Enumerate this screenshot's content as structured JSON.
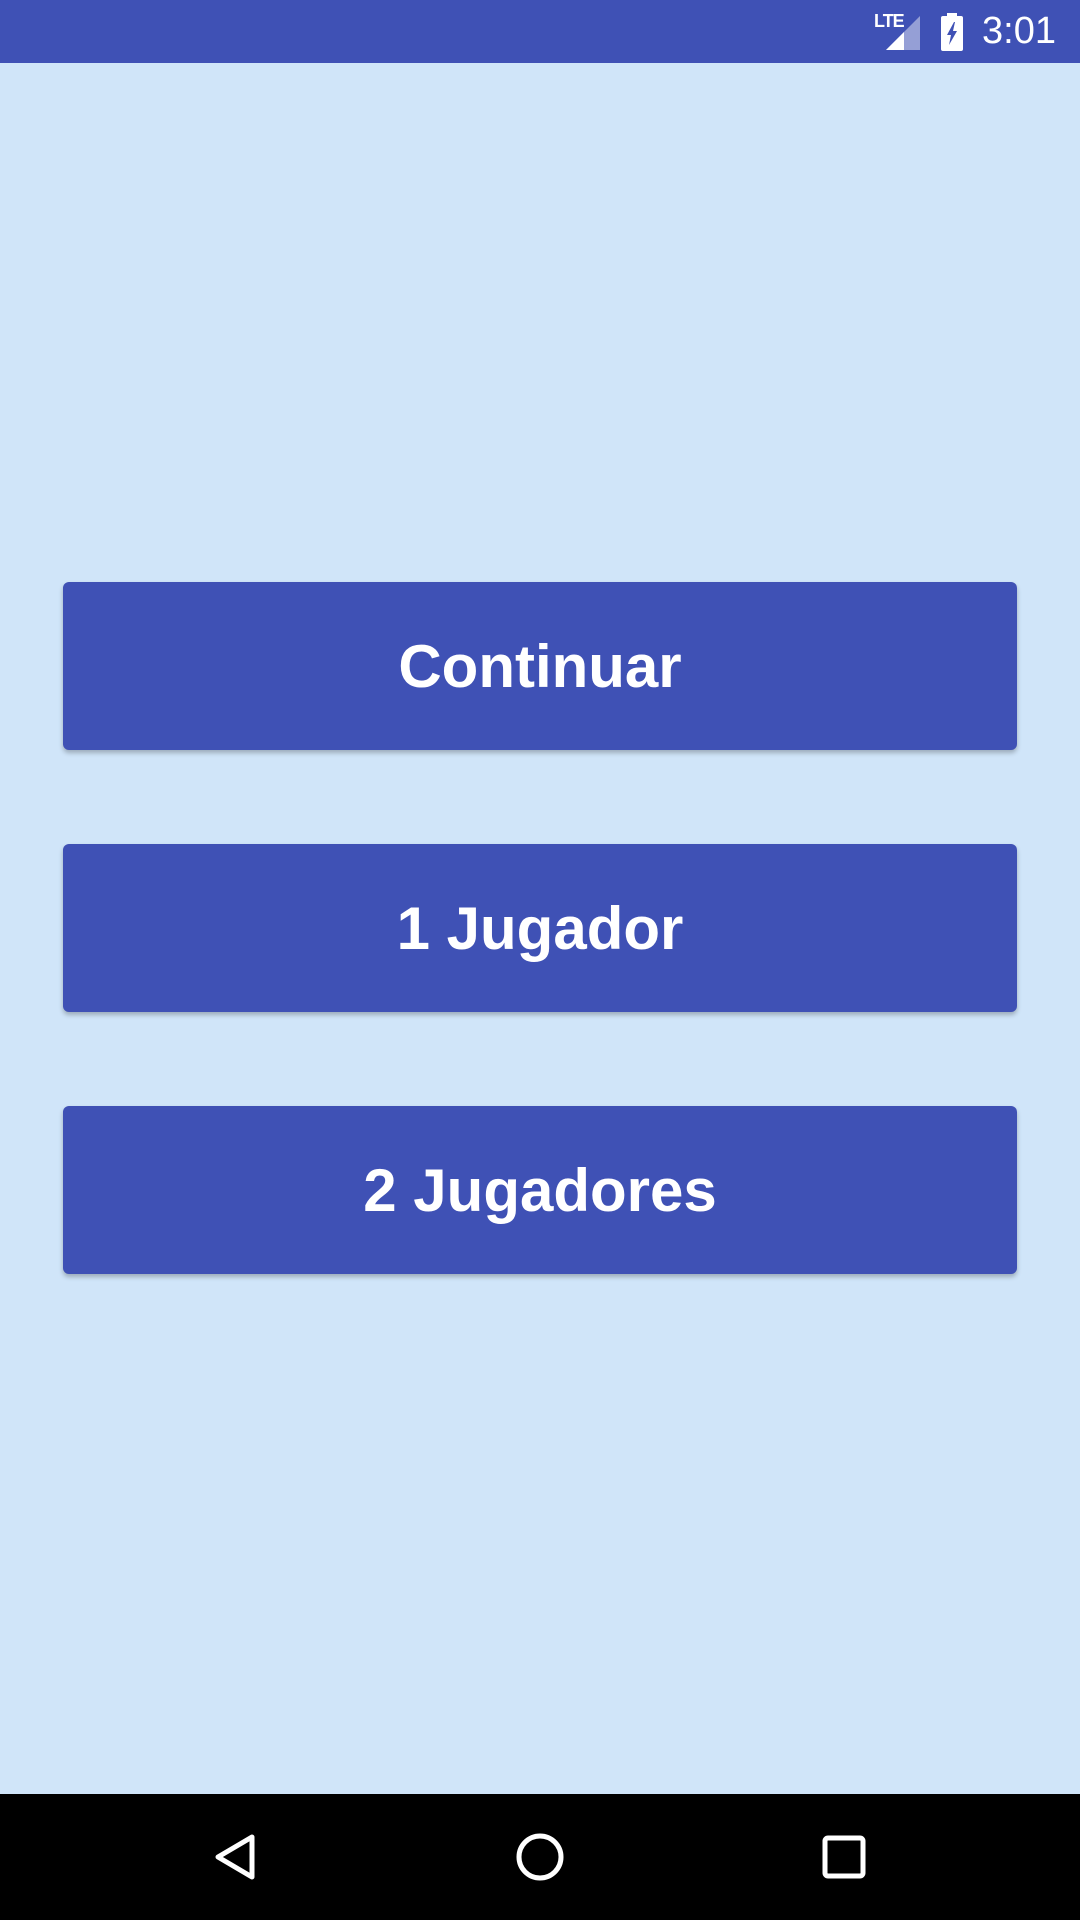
{
  "status_bar": {
    "network_label": "LTE",
    "time": "3:01",
    "color": "#3F51B5"
  },
  "menu": {
    "buttons": [
      {
        "label": "Continuar"
      },
      {
        "label": "1 Jugador"
      },
      {
        "label": "2 Jugadores"
      }
    ]
  },
  "nav_bar": {
    "back_icon": "back-triangle",
    "home_icon": "home-circle",
    "recents_icon": "recents-square"
  },
  "colors": {
    "background": "#D0E5F9",
    "accent": "#3F51B5",
    "button_text": "#FFFFFF"
  }
}
